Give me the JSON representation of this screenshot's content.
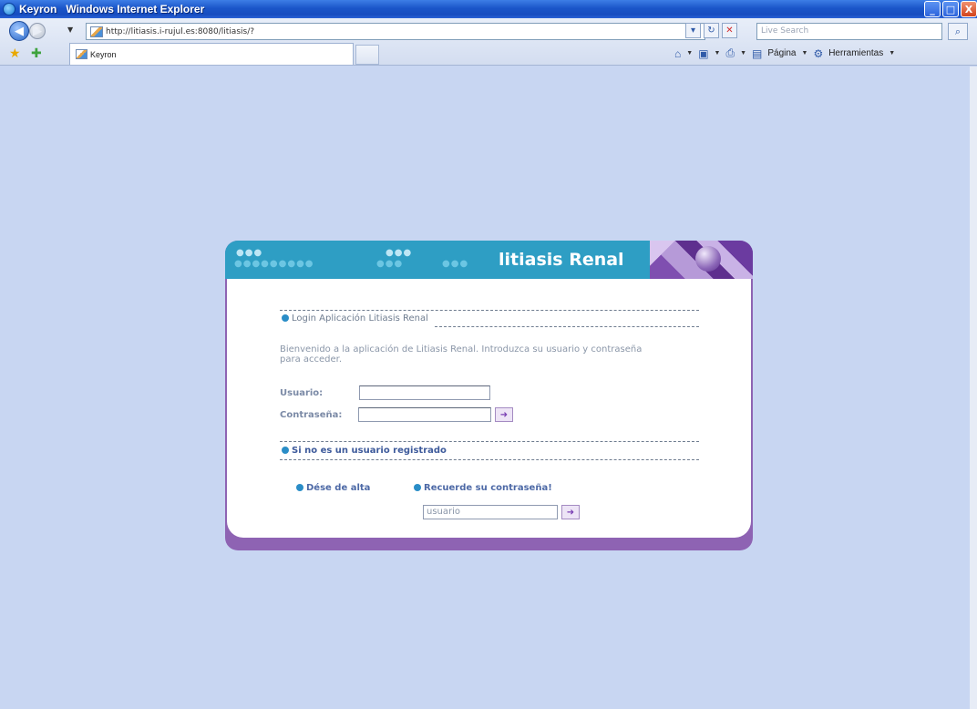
{
  "window": {
    "title": "Keyron   Windows Internet Explorer",
    "minimize": "_",
    "maximize": "□",
    "close": "X"
  },
  "browser": {
    "url": "http://litiasis.i-rujul.es:8080/litiasis/?",
    "search_placeholder": "Live Search",
    "tab_label": "Keyron",
    "toolbar": {
      "page_label": "Página",
      "tools_label": "Herramientas"
    }
  },
  "app": {
    "brand": "litiasis Renal",
    "login_heading": "Login Aplicación Litiasis Renal",
    "intro": "Bienvenido a la aplicación de Litiasis Renal. Introduzca su usuario y contraseña para acceder.",
    "username_label": "Usuario:",
    "password_label": "Contraseña:",
    "not_registered_heading": "Si no es un usuario registrado",
    "signup_link": "Dése de alta",
    "remember_link": "Recuerde su contraseña!",
    "recover_input_value": "usuario"
  }
}
